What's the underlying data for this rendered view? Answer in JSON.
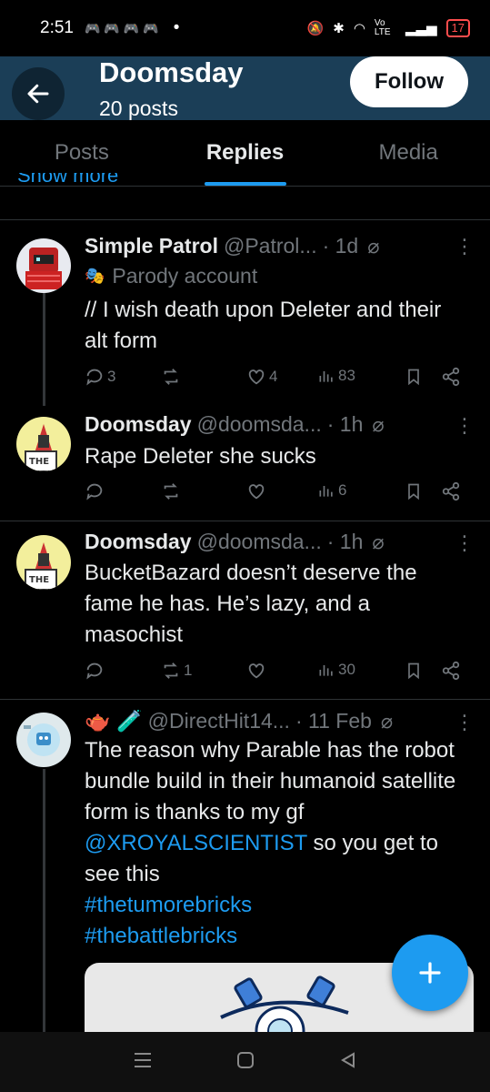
{
  "status_bar": {
    "time": "2:51",
    "notif_icons": [
      "gamepad-icon",
      "gamepad-icon",
      "gamepad-icon",
      "gamepad-icon"
    ],
    "battery": "17",
    "network": "Vo LTE"
  },
  "header": {
    "title": "Doomsday",
    "subtitle": "20 posts",
    "follow_label": "Follow"
  },
  "tabs": [
    {
      "label": "Posts",
      "active": false
    },
    {
      "label": "Replies",
      "active": true
    },
    {
      "label": "Media",
      "active": false
    }
  ],
  "show_more": "Show more",
  "posts": [
    {
      "name": "Simple Patrol",
      "handle": "@Patrol...",
      "time": "· 1d",
      "badge": "Parody account",
      "text": "// I wish death upon Deleter and their alt form",
      "replies": "3",
      "reposts": "",
      "likes": "4",
      "views": "83"
    },
    {
      "name": "Doomsday",
      "handle": "@doomsda...",
      "time": "· 1h",
      "text": "Rape Deleter she sucks",
      "replies": "",
      "reposts": "",
      "likes": "",
      "views": "6"
    },
    {
      "name": "Doomsday",
      "handle": "@doomsda...",
      "time": "· 1h",
      "text": "BucketBazard doesn’t deserve the fame he has. He’s lazy, and a masochist",
      "replies": "",
      "reposts": "1",
      "likes": "",
      "views": "30"
    },
    {
      "name": "🫖 🧪",
      "handle": "@DirectHit14...",
      "time": "· 11 Feb",
      "text_before": "The reason why Parable has the robot bundle build in their humanoid satellite form is thanks to my gf ",
      "mention": "@XROYALSCIENTIST",
      "text_after": " so you get to see this",
      "hashtag1": "#thetumorebricks",
      "hashtag2": "#thebattlebricks"
    }
  ],
  "colors": {
    "accent": "#1d9bf0",
    "header_bg": "#1b3e57",
    "muted": "#71767b"
  }
}
